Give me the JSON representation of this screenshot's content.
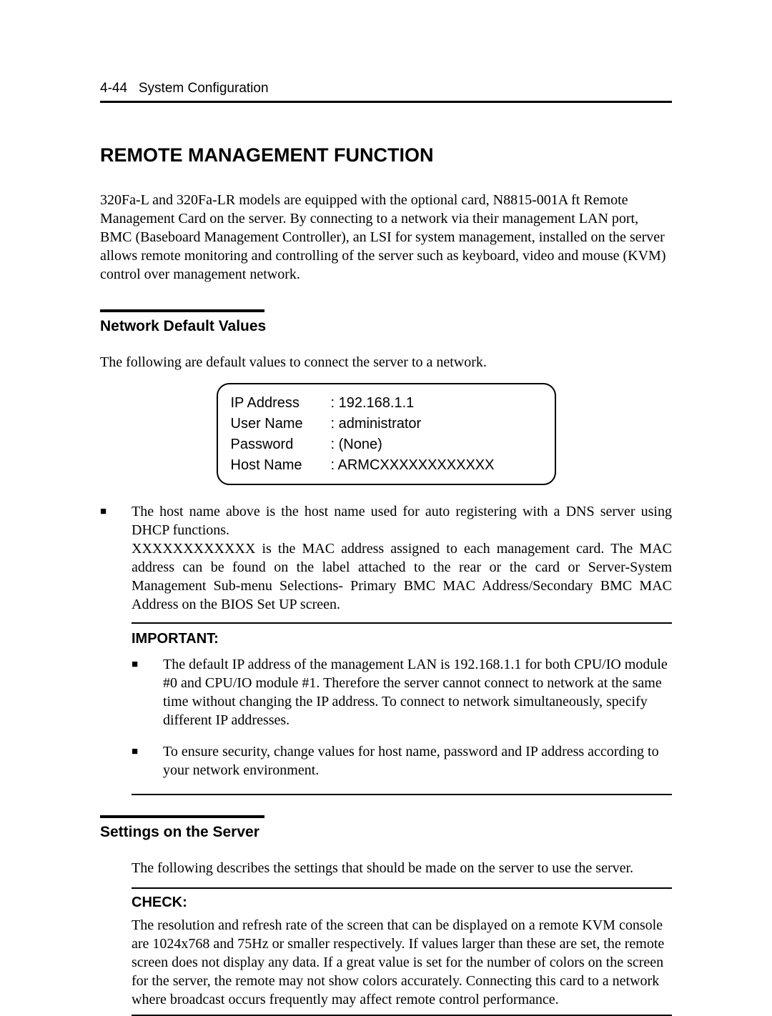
{
  "header": {
    "page_num": "4-44",
    "chapter": "System Configuration"
  },
  "title": "REMOTE MANAGEMENT FUNCTION",
  "intro": "320Fa-L and 320Fa-LR models are equipped with the optional card, N8815-001A ft Remote Management Card on the server. By connecting to a network via their management LAN port, BMC (Baseboard Management Controller), an LSI for system management, installed on the server allows remote monitoring and controlling of the server such as keyboard, video and mouse (KVM) control over management network.",
  "network_defaults": {
    "heading": "Network Default Values",
    "lead": "The following are default values to connect the server to a network.",
    "rows": [
      {
        "label": "IP Address",
        "value": ": 192.168.1.1"
      },
      {
        "label": "User Name",
        "value": ": administrator"
      },
      {
        "label": "Password",
        "value": ": (None)"
      },
      {
        "label": "Host Name",
        "value": ": ARMCXXXXXXXXXXXX"
      }
    ],
    "note_bullet": "The host name above is the host name used for auto registering with a DNS server using DHCP functions.",
    "note_detail": "XXXXXXXXXXXX is the MAC address assigned to each management card. The MAC address can be found on the label attached to the rear or the card or Server-System Management Sub-menu Selections- Primary BMC MAC Address/Secondary BMC MAC Address on the BIOS Set UP screen."
  },
  "important": {
    "title": "IMPORTANT:",
    "items": [
      "The default IP address of the management LAN is 192.168.1.1 for both CPU/IO module #0 and CPU/IO module #1. Therefore the server cannot connect to network at the same time without changing the IP address. To connect to network simultaneously, specify different IP addresses.",
      "To ensure security, change values for host name, password and IP address according to your network environment."
    ]
  },
  "settings": {
    "heading": "Settings on the Server",
    "lead": "The following describes the settings that should be made on the server to use the server."
  },
  "check": {
    "title": "CHECK:",
    "body": "The resolution and refresh rate of the screen that can be displayed on a remote KVM console are 1024x768 and 75Hz or smaller respectively. If values larger than these are set, the remote screen does not display any data. If a great value is set for the number of colors on the screen for the server, the remote may not show colors accurately. Connecting this card to a network where broadcast occurs frequently may affect remote control performance."
  }
}
